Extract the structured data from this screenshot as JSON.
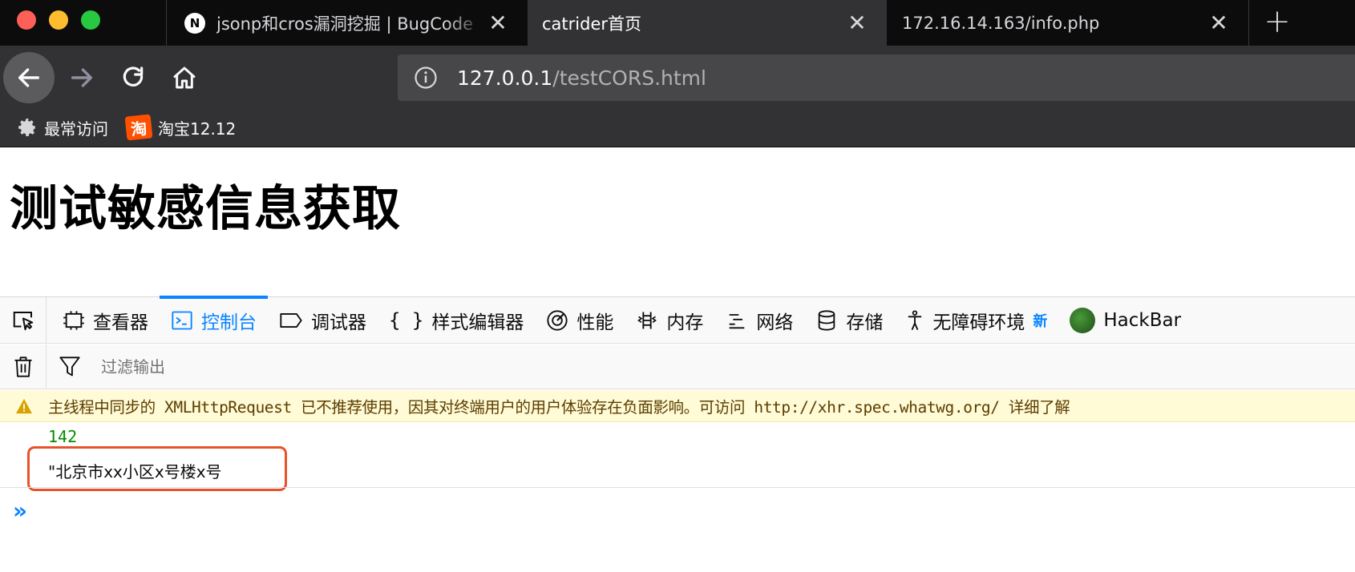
{
  "browser": {
    "tabs": [
      {
        "favicon": "N",
        "label": "jsonp和cros漏洞挖掘 | BugCode",
        "active": false
      },
      {
        "label": "catrider首页",
        "active": true
      },
      {
        "label": "172.16.14.163/info.php",
        "active": false
      }
    ],
    "url": {
      "domain": "127.0.0.1",
      "path": "/testCORS.html"
    },
    "bookmarks": [
      {
        "icon": "gear-icon",
        "label": "最常访问"
      },
      {
        "icon": "taobao-icon",
        "icon_text": "淘",
        "label": "淘宝12.12"
      }
    ]
  },
  "page": {
    "heading": "测试敏感信息获取"
  },
  "devtools": {
    "tabs": [
      {
        "icon": "inspector-icon",
        "label": "查看器"
      },
      {
        "icon": "console-icon",
        "label": "控制台",
        "active": true
      },
      {
        "icon": "debugger-icon",
        "label": "调试器"
      },
      {
        "icon": "style-editor-icon",
        "label": "样式编辑器"
      },
      {
        "icon": "performance-icon",
        "label": "性能"
      },
      {
        "icon": "memory-icon",
        "label": "内存"
      },
      {
        "icon": "network-icon",
        "label": "网络"
      },
      {
        "icon": "storage-icon",
        "label": "存储"
      },
      {
        "icon": "accessibility-icon",
        "label": "无障碍环境",
        "badge": "新"
      },
      {
        "icon": "hackbar-icon",
        "label": "HackBar"
      }
    ],
    "filter_placeholder": "过滤输出",
    "console": {
      "warning": "主线程中同步的 XMLHttpRequest 已不推荐使用，因其对终端用户的用户体验存在负面影响。可访问 http://xhr.spec.whatwg.org/ 详细了解",
      "number_output": "142",
      "string_output": "\"北京市xx小区x号楼x号"
    }
  },
  "colors": {
    "accent": "#0a84ff",
    "highlight_box": "#e8522a",
    "number_green": "#058b00"
  }
}
